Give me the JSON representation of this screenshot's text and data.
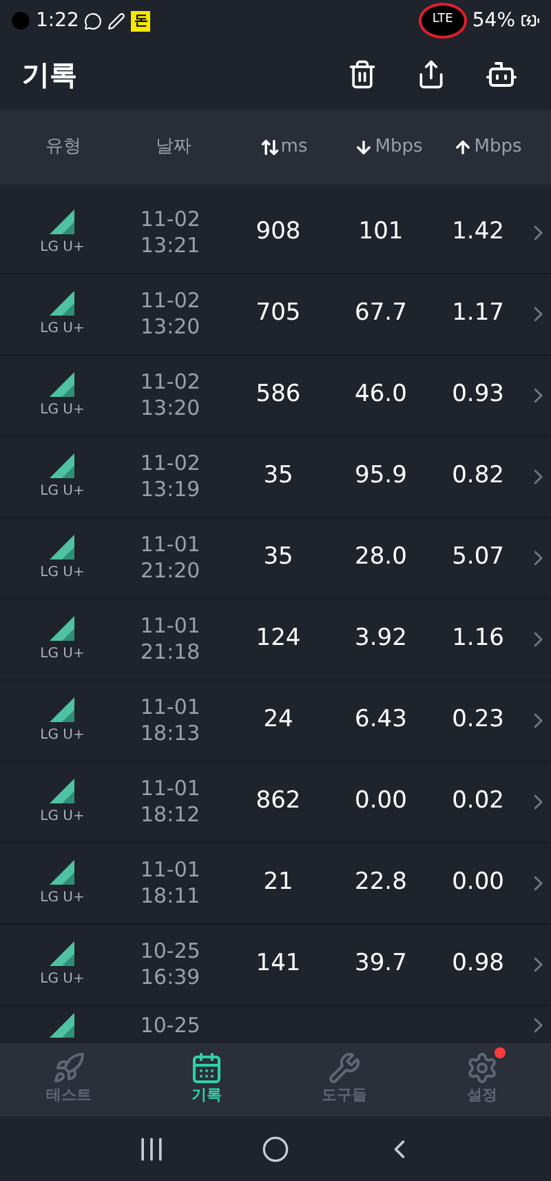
{
  "status_bar": {
    "time": "1:22",
    "badge": "돈",
    "network": "LTE",
    "battery": "54%"
  },
  "header": {
    "title": "기록"
  },
  "columns": [
    {
      "label": "유형"
    },
    {
      "label": "날짜"
    },
    {
      "label": "ms"
    },
    {
      "label": "Mbps"
    },
    {
      "label": "Mbps"
    }
  ],
  "rows": [
    {
      "carrier": "LG U+",
      "date": "11-02",
      "time": "13:21",
      "ping": "908",
      "download": "101",
      "upload": "1.42"
    },
    {
      "carrier": "LG U+",
      "date": "11-02",
      "time": "13:20",
      "ping": "705",
      "download": "67.7",
      "upload": "1.17"
    },
    {
      "carrier": "LG U+",
      "date": "11-02",
      "time": "13:20",
      "ping": "586",
      "download": "46.0",
      "upload": "0.93"
    },
    {
      "carrier": "LG U+",
      "date": "11-02",
      "time": "13:19",
      "ping": "35",
      "download": "95.9",
      "upload": "0.82"
    },
    {
      "carrier": "LG U+",
      "date": "11-01",
      "time": "21:20",
      "ping": "35",
      "download": "28.0",
      "upload": "5.07"
    },
    {
      "carrier": "LG U+",
      "date": "11-01",
      "time": "21:18",
      "ping": "124",
      "download": "3.92",
      "upload": "1.16"
    },
    {
      "carrier": "LG U+",
      "date": "11-01",
      "time": "18:13",
      "ping": "24",
      "download": "6.43",
      "upload": "0.23"
    },
    {
      "carrier": "LG U+",
      "date": "11-01",
      "time": "18:12",
      "ping": "862",
      "download": "0.00",
      "upload": "0.02"
    },
    {
      "carrier": "LG U+",
      "date": "11-01",
      "time": "18:11",
      "ping": "21",
      "download": "22.8",
      "upload": "0.00"
    },
    {
      "carrier": "LG U+",
      "date": "10-25",
      "time": "16:39",
      "ping": "141",
      "download": "39.7",
      "upload": "0.98"
    },
    {
      "date": "10-25"
    }
  ],
  "bottom_nav": [
    {
      "label": "테스트",
      "selected": false,
      "notification": false
    },
    {
      "label": "기록",
      "selected": true,
      "notification": false
    },
    {
      "label": "도구들",
      "selected": false,
      "notification": false
    },
    {
      "label": "설정",
      "selected": false,
      "notification": true
    }
  ]
}
